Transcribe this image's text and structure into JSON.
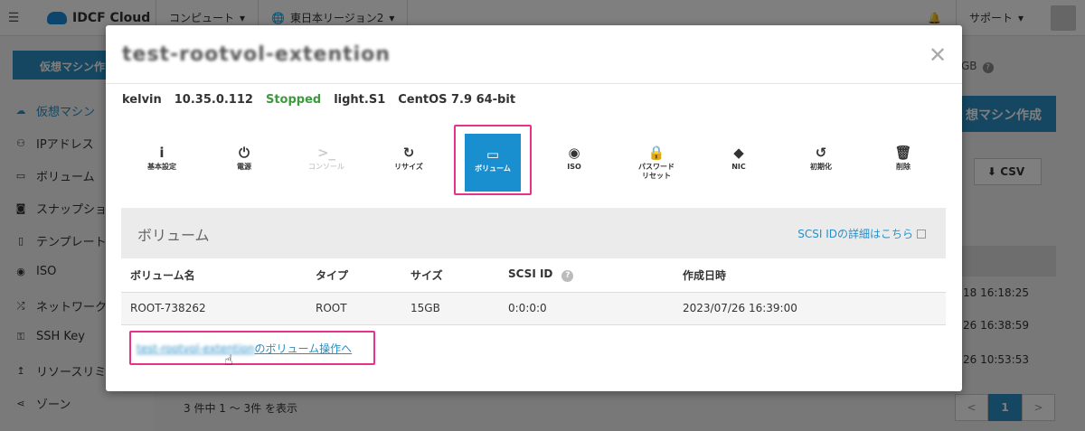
{
  "topbar": {
    "logo": "IDCF Cloud",
    "menu_compute": "コンピュート",
    "menu_region": "東日本リージョン2",
    "menu_support": "サポート"
  },
  "sidebar": {
    "create_button": "仮想マシン作",
    "items": [
      {
        "label": "仮想マシン",
        "icon": "cloud-icon"
      },
      {
        "label": "IPアドレス",
        "icon": "network-icon"
      },
      {
        "label": "ボリューム",
        "icon": "disk-icon"
      },
      {
        "label": "スナップショ",
        "icon": "camera-icon"
      },
      {
        "label": "テンプレート",
        "icon": "file-icon"
      },
      {
        "label": "ISO",
        "icon": "disc-icon"
      },
      {
        "label": "ネットワーク",
        "icon": "shuffle-icon"
      },
      {
        "label": "SSH Key",
        "icon": "key-icon"
      },
      {
        "label": "リソースリミ",
        "icon": "arrow-icon"
      },
      {
        "label": "ゾーン",
        "icon": "share-icon"
      }
    ]
  },
  "background": {
    "gb_text": "GB",
    "create_vm_button": "想マシン作成",
    "csv_button": "CSV",
    "times": [
      "18 16:18:25",
      "26 16:38:59",
      "26 10:53:53"
    ],
    "count_text": "3 件中 1 〜 3件 を表示",
    "pager": {
      "prev": "<",
      "current": "1",
      "next": ">"
    }
  },
  "modal": {
    "title": "test-rootvol-extention",
    "info": {
      "user": "kelvin",
      "ip": "10.35.0.112",
      "status": "Stopped",
      "plan": "light.S1",
      "os": "CentOS 7.9 64-bit"
    },
    "status_color": "#3c9a3c",
    "actions": [
      {
        "label": "基本設定",
        "icon": "info-icon",
        "glyph": "i"
      },
      {
        "label": "電源",
        "icon": "power-icon",
        "glyph": "⏻"
      },
      {
        "label": "コンソール",
        "icon": "terminal-icon",
        "glyph": ">_",
        "disabled": true
      },
      {
        "label": "リサイズ",
        "icon": "refresh-icon",
        "glyph": "↻"
      },
      {
        "label": "ボリューム",
        "icon": "hdd-icon",
        "glyph": "▭",
        "selected": true
      },
      {
        "label": "ISO",
        "icon": "disc-icon",
        "glyph": "◉"
      },
      {
        "label": "パスワード",
        "label2": "リセット",
        "icon": "lock-icon",
        "glyph": "🔒"
      },
      {
        "label": "NIC",
        "icon": "tag-icon",
        "glyph": "◆"
      },
      {
        "label": "初期化",
        "icon": "history-icon",
        "glyph": "↺"
      },
      {
        "label": "削除",
        "icon": "trash-icon",
        "glyph": "🗑"
      }
    ],
    "volume_panel": {
      "title": "ボリューム",
      "scsi_link": "SCSI IDの詳細はこちら",
      "columns": [
        "ボリューム名",
        "タイプ",
        "サイズ",
        "SCSI ID",
        "作成日時"
      ],
      "rows": [
        [
          "ROOT-738262",
          "ROOT",
          "15GB",
          "0:0:0:0",
          "2023/07/26 16:39:00"
        ]
      ]
    },
    "op_link_blurred": "test-rootvol-extention",
    "op_link_suffix": "のボリューム操作へ",
    "accent_color": "#1a8fd0",
    "highlight_color": "#e8318a"
  }
}
